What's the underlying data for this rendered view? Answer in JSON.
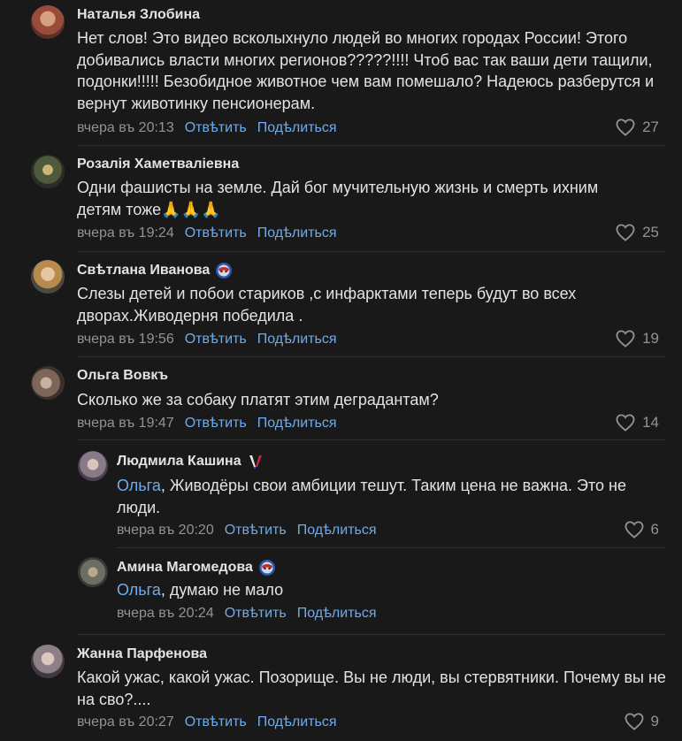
{
  "comments": [
    {
      "author": "Наталья Злобина",
      "text": "Нет слов! Это видео всколыхнуло людей во многих городах России! Этого добивались власти многих регионов?????!!!! Чтоб вас так ваши дети тащили, подонки!!!!! Безобидное животное чем вам помешало? Надеюсь разберутся и вернут животинку пенсионерам.",
      "time": "вчера въ 20:13",
      "reply": "Отвѣтить",
      "share": "Подѣлиться",
      "likes": "27",
      "avatar_color": "#b06a52"
    },
    {
      "author": "Розалія Хаметваліевна",
      "text": "Одни фашисты на земле. Дай бог мучительную жизнь и смерть ихним детям тоже🙏🙏🙏",
      "time": "вчера въ 19:24",
      "reply": "Отвѣтить",
      "share": "Подѣлиться",
      "likes": "25",
      "avatar_color": "#6a6a55"
    },
    {
      "author": "Свѣтлана Иванова",
      "text": "Слезы детей и побои стариков ,с инфарктами теперь будут во всех дворах.Живодерня победила .",
      "time": "вчера въ 19:56",
      "reply": "Отвѣтить",
      "share": "Подѣлиться",
      "likes": "19",
      "badge": "shield-badge-icon",
      "avatar_color": "#a78b5c"
    },
    {
      "author": "Ольга Вовкъ",
      "text": "Сколько же за собаку платят этим деградантам?",
      "time": "вчера въ 19:47",
      "reply": "Отвѣтить",
      "share": "Подѣлиться",
      "likes": "14",
      "avatar_color": "#7a6a62"
    },
    {
      "author": "Людмила Кашина",
      "mention": "Ольга",
      "text": ", Живодёры свои амбиции тешут. Таким цена не важна. Это не люди.",
      "time": "вчера въ 20:20",
      "reply": "Отвѣтить",
      "share": "Подѣлиться",
      "likes": "6",
      "badge": "victory-badge-icon",
      "avatar_color": "#8a7e8a"
    },
    {
      "author": "Амина Магомедова",
      "mention": "Ольга",
      "text": ", думаю не мало",
      "time": "вчера въ 20:24",
      "reply": "Отвѣтить",
      "share": "Подѣлиться",
      "likes": "",
      "badge": "shield-badge-icon",
      "avatar_color": "#6b6f62"
    },
    {
      "author": "Жанна Парфенова",
      "text": "Какой ужас, какой ужас. Позорище. Вы не люди, вы стервятники. Почему вы не на сво?....",
      "time": "вчера въ 20:27",
      "reply": "Отвѣтить",
      "share": "Подѣлиться",
      "likes": "9",
      "avatar_color": "#8e7f86"
    }
  ]
}
